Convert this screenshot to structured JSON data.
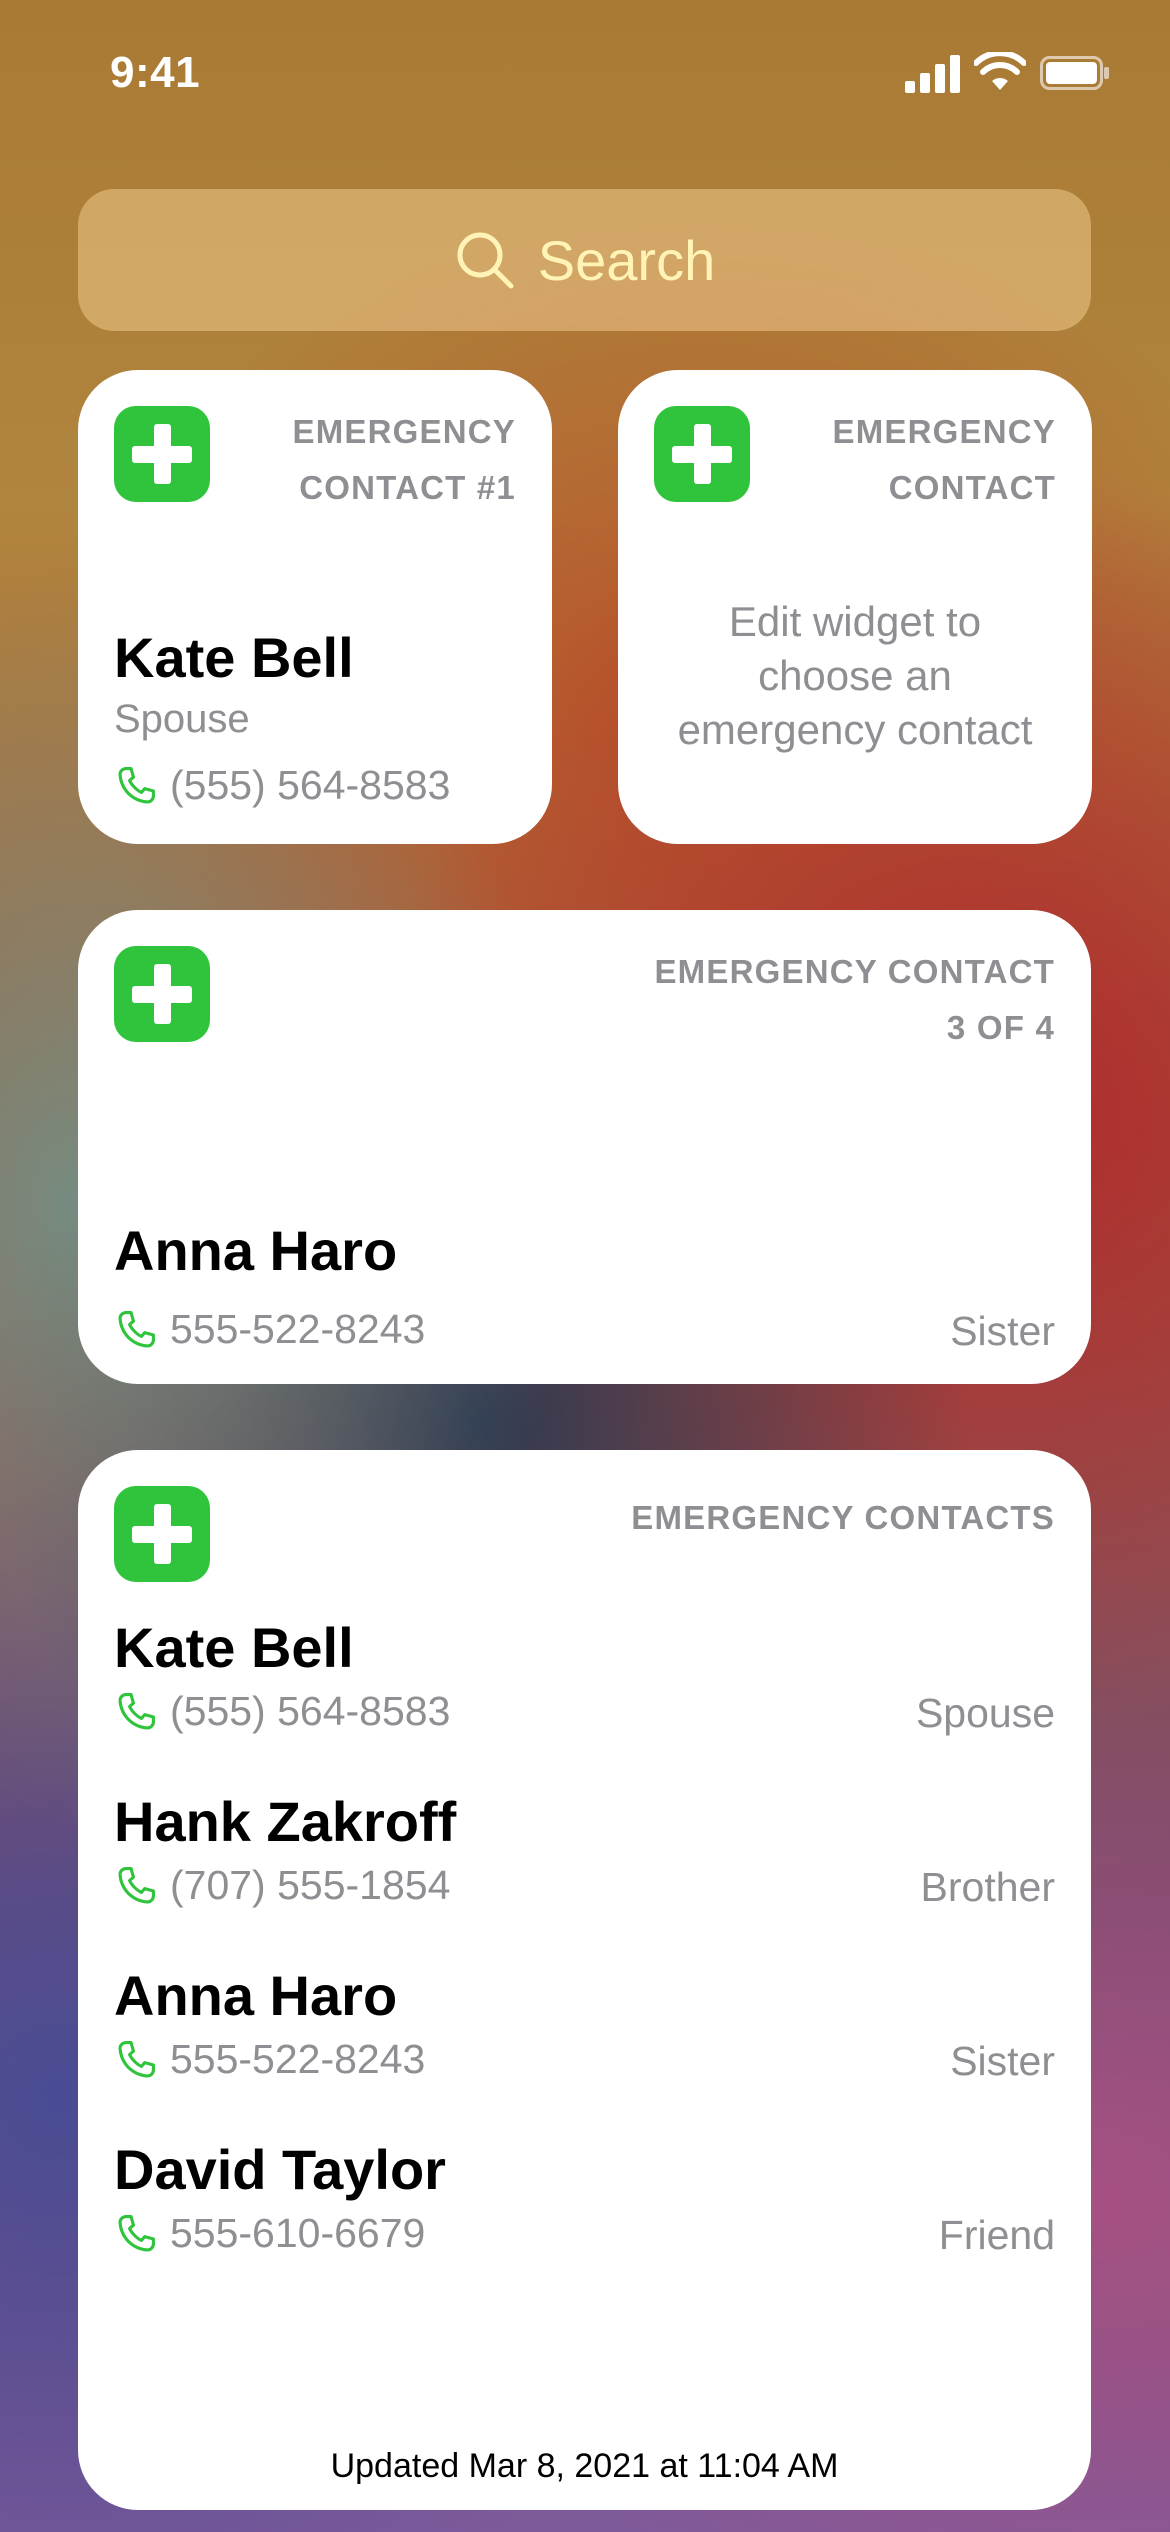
{
  "status_bar": {
    "time": "9:41"
  },
  "search": {
    "label": "Search"
  },
  "colors": {
    "accent_green": "#2fc43b",
    "secondary_text": "#8e8e93"
  },
  "widget_small_1": {
    "caption_line1": "EMERGENCY",
    "caption_line2": "CONTACT #1",
    "name": "Kate Bell",
    "relation": "Spouse",
    "phone": "(555) 564-8583"
  },
  "widget_small_2": {
    "caption_line1": "EMERGENCY",
    "caption_line2": "CONTACT",
    "message_line1": "Edit widget to",
    "message_line2": "choose an",
    "message_line3": "emergency contact"
  },
  "widget_medium": {
    "caption_line1": "EMERGENCY CONTACT",
    "caption_line2": "3 OF 4",
    "name": "Anna Haro",
    "phone": "555-522-8243",
    "relation": "Sister"
  },
  "widget_large": {
    "caption": "EMERGENCY CONTACTS",
    "contacts": [
      {
        "name": "Kate Bell",
        "phone": "(555) 564-8583",
        "relation": "Spouse"
      },
      {
        "name": "Hank Zakroff",
        "phone": "(707) 555-1854",
        "relation": "Brother"
      },
      {
        "name": "Anna Haro",
        "phone": "555-522-8243",
        "relation": "Sister"
      },
      {
        "name": "David Taylor",
        "phone": "555-610-6679",
        "relation": "Friend"
      }
    ],
    "updated": "Updated Mar 8, 2021 at 11:04 AM"
  }
}
